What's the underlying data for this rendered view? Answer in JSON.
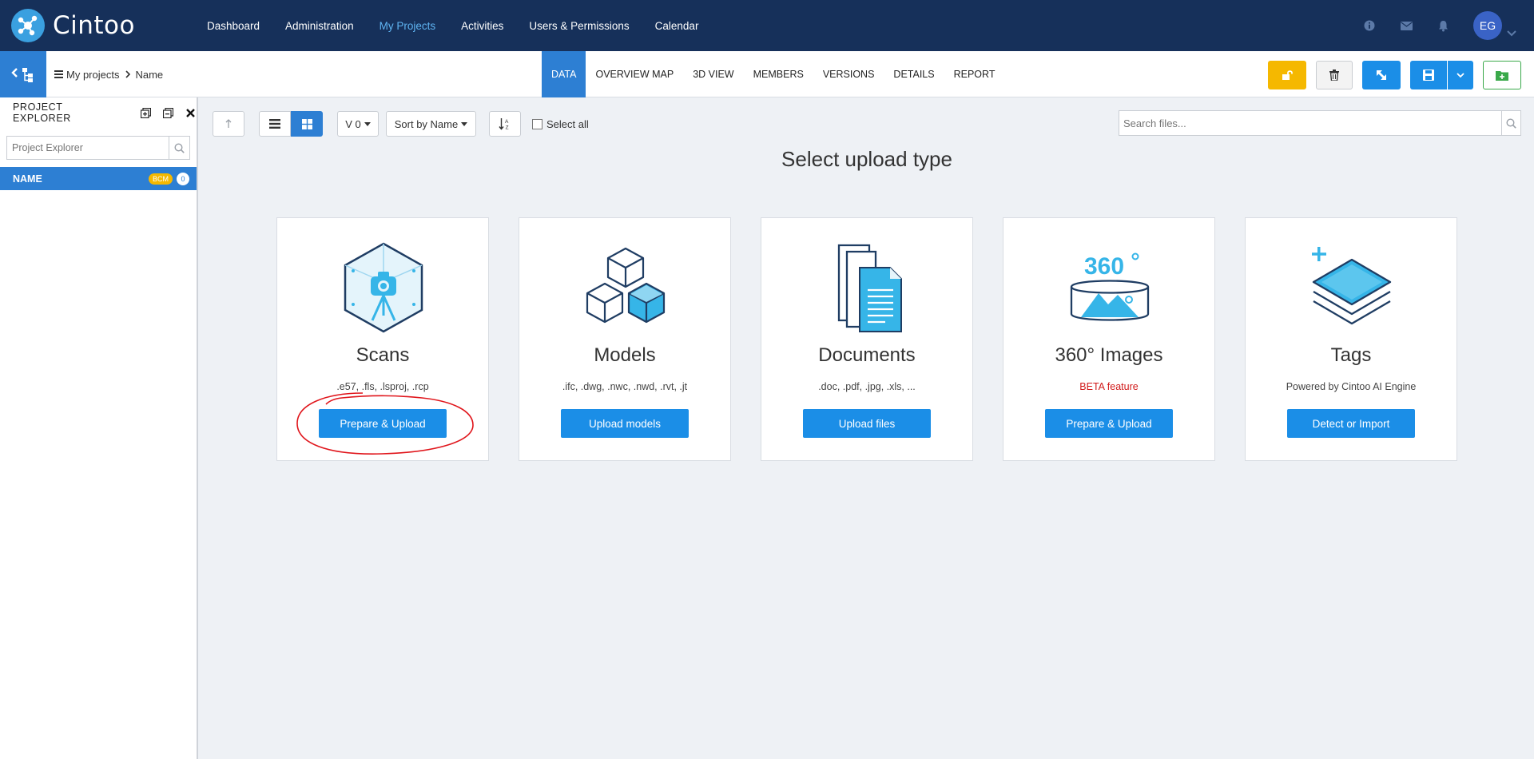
{
  "app": {
    "brand": "Cintoo",
    "colors": {
      "navy": "#16305a",
      "primary": "#2d7fd3",
      "button": "#1b8ee7",
      "warning": "#f5b800",
      "success": "#3aa94a",
      "beta": "#d11a1a"
    }
  },
  "topnav": {
    "items": [
      "Dashboard",
      "Administration",
      "My Projects",
      "Activities",
      "Users & Permissions",
      "Calendar"
    ],
    "active": "My Projects",
    "icons": [
      "info-icon",
      "mail-icon",
      "bell-icon"
    ],
    "avatar_initials": "EG"
  },
  "subbar": {
    "breadcrumb": {
      "root": "My projects",
      "current": "Name"
    },
    "tabs": [
      "DATA",
      "OVERVIEW MAP",
      "3D VIEW",
      "MEMBERS",
      "VERSIONS",
      "DETAILS",
      "REPORT"
    ],
    "active_tab": "DATA",
    "actions": [
      "unlock-icon",
      "trash-icon",
      "share-icon",
      "save-icon",
      "chevron-down-icon",
      "new-folder-icon"
    ]
  },
  "sidebar": {
    "title": "PROJECT EXPLORER",
    "search_placeholder": "Project Explorer",
    "node": {
      "label": "NAME",
      "badge": "BCM",
      "count": "0"
    }
  },
  "toolbar": {
    "version": "V 0",
    "sort": "Sort by Name",
    "select_all": "Select all",
    "search_placeholder": "Search files..."
  },
  "main": {
    "title": "Select upload type",
    "cards": [
      {
        "icon": "scan-camera-icon",
        "title": "Scans",
        "subtitle": ".e57, .fls, .lsproj, .rcp",
        "button": "Prepare & Upload"
      },
      {
        "icon": "cubes-icon",
        "title": "Models",
        "subtitle": ".ifc, .dwg, .nwc, .nwd, .rvt, .jt",
        "button": "Upload models"
      },
      {
        "icon": "documents-icon",
        "title": "Documents",
        "subtitle": ".doc, .pdf, .jpg, .xls, ...",
        "button": "Upload files"
      },
      {
        "icon": "panorama-360-icon",
        "title": "360° Images",
        "subtitle": "BETA feature",
        "button": "Prepare & Upload"
      },
      {
        "icon": "tags-layers-icon",
        "title": "Tags",
        "subtitle": "Powered by Cintoo AI Engine",
        "button": "Detect or Import"
      }
    ]
  }
}
